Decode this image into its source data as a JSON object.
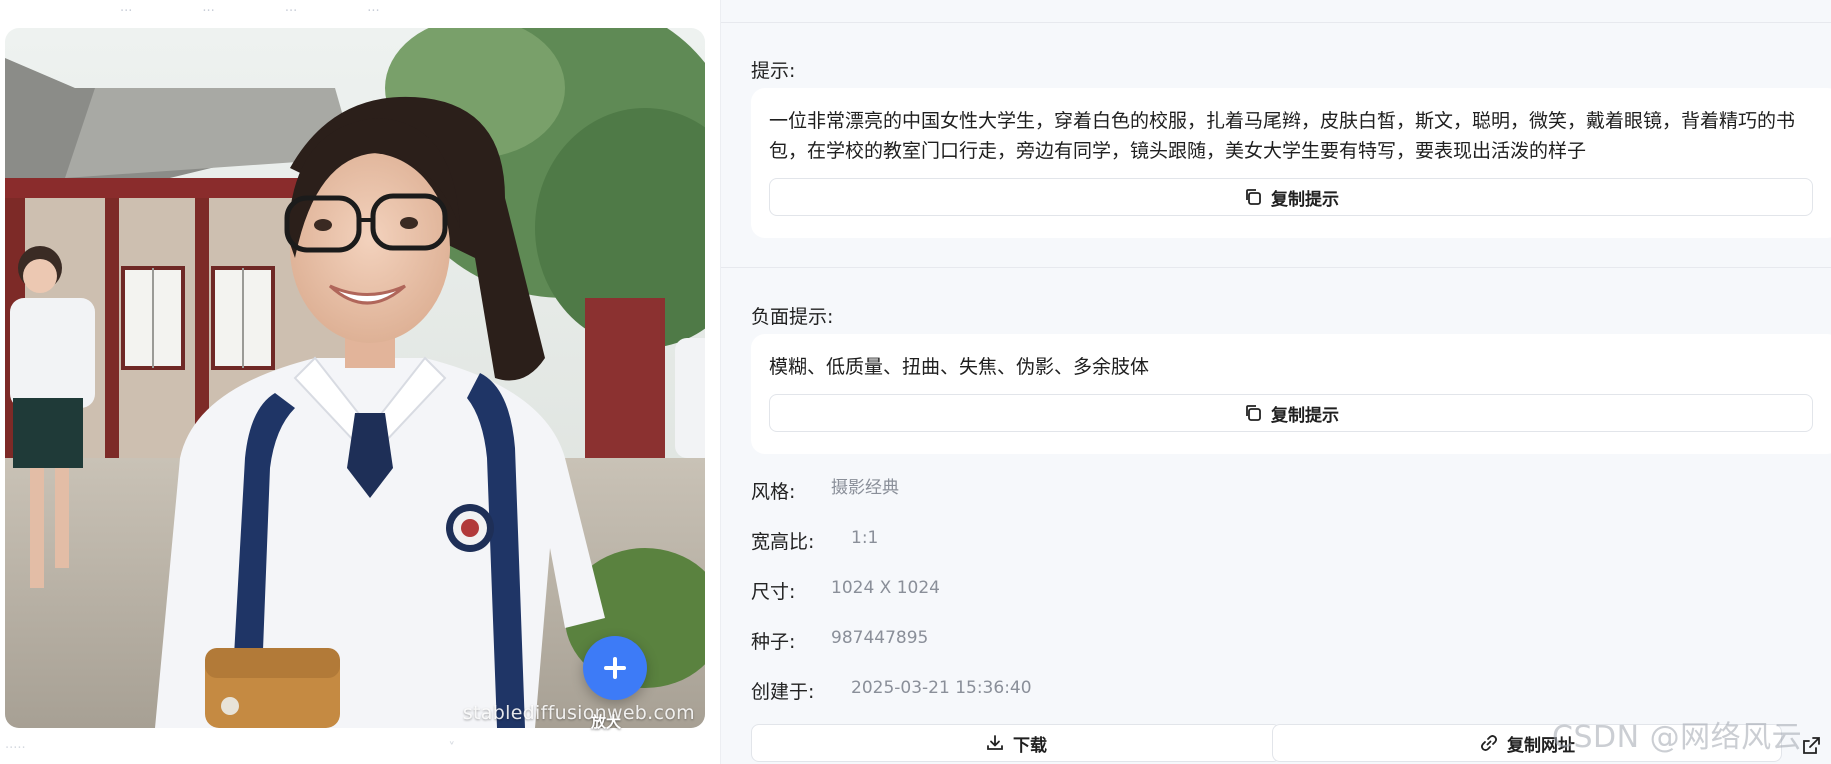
{
  "left": {
    "top_tabs": [
      "···",
      "···",
      "···",
      "···"
    ],
    "image_watermark": "stablediffusionweb.com",
    "zoom_label": "放大",
    "bottom_left_text": "·····",
    "bottom_right_text": "˅"
  },
  "prompt": {
    "label": "提示:",
    "text": "一位非常漂亮的中国女性大学生，穿着白色的校服，扎着马尾辫，皮肤白皙，斯文，聪明，微笑，戴着眼镜，背着精巧的书包，在学校的教室门口行走，旁边有同学，镜头跟随，美女大学生要有特写，要表现出活泼的样子",
    "copy_label": "复制提示"
  },
  "negative": {
    "label": "负面提示:",
    "text": "模糊、低质量、扭曲、失焦、伪影、多余肢体",
    "copy_label": "复制提示"
  },
  "meta": {
    "style_key": "风格:",
    "style_val": "摄影经典",
    "ratio_key": "宽高比:",
    "ratio_val": "1:1",
    "size_key": "尺寸:",
    "size_val": "1024 X 1024",
    "seed_key": "种子:",
    "seed_val": "987447895",
    "created_key": "创建于:",
    "created_val": "2025-03-21 15:36:40"
  },
  "actions": {
    "download_label": "下载",
    "copy_url_label": "复制网址"
  },
  "watermark": "CSDN @网络风云",
  "colors": {
    "accent": "#3d7bf7",
    "background": "#f6f8fb",
    "card": "#ffffff",
    "muted_text": "#8a8f99"
  },
  "icons": [
    "copy-icon",
    "download-icon",
    "link-icon",
    "plus-icon",
    "external-link-icon"
  ]
}
